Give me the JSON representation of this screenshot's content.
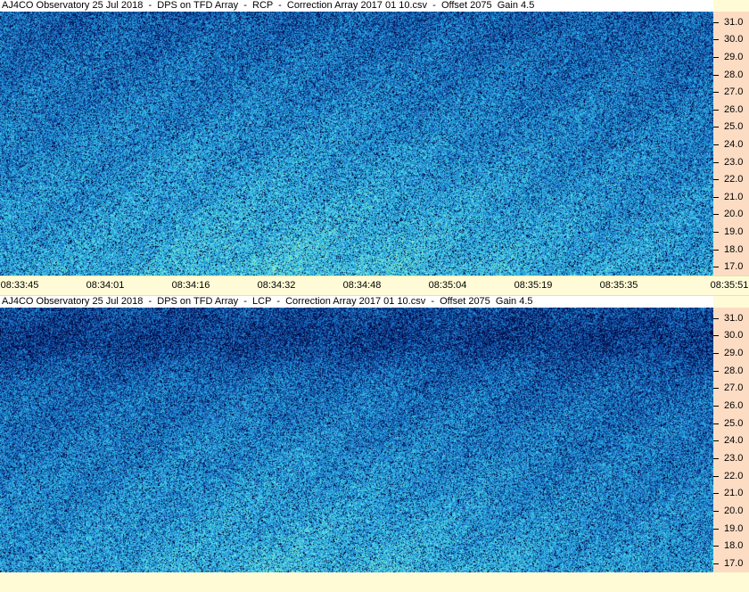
{
  "chart_data": [
    {
      "type": "heatmap",
      "title": "AJ4CO Observatory 25 Jul 2018  -  DPS on TFD Array  -  RCP  -  Correction Array 2017 01 10.csv  -  Offset 2075  Gain 4.5",
      "xlabel": "",
      "ylabel": "",
      "x_ticks": [
        "08:33:45",
        "08:34:01",
        "08:34:16",
        "08:34:32",
        "08:34:48",
        "08:35:04",
        "08:35:19",
        "08:35:35",
        "08:35:51"
      ],
      "y_ticks": [
        "31.0",
        "30.0",
        "29.0",
        "28.0",
        "27.0",
        "26.0",
        "25.0",
        "24.0",
        "23.0",
        "22.0",
        "21.0",
        "20.0",
        "19.0",
        "18.0",
        "17.0"
      ],
      "ylim": [
        16.5,
        31.6
      ],
      "colormap": [
        "#000033",
        "#0a2e7a",
        "#1a6fc9",
        "#2aaee0",
        "#5fe6e6",
        "#c8f59a"
      ],
      "description_values": {
        "intensity_trend": "higher at lower frequencies (17-22) and mid-time, lower near 28-31"
      }
    },
    {
      "type": "heatmap",
      "title": "AJ4CO Observatory 25 Jul 2018  -  DPS on TFD Array  -  LCP  -  Correction Array 2017 01 10.csv  -  Offset 2075  Gain 4.5",
      "xlabel": "",
      "ylabel": "",
      "x_ticks": [],
      "y_ticks": [
        "31.0",
        "30.0",
        "29.0",
        "28.0",
        "27.0",
        "26.0",
        "25.0",
        "24.0",
        "23.0",
        "22.0",
        "21.0",
        "20.0",
        "19.0",
        "18.0",
        "17.0"
      ],
      "ylim": [
        16.5,
        31.6
      ],
      "colormap": [
        "#000033",
        "#0a2e7a",
        "#1a6fc9",
        "#2aaee0",
        "#5fe6e6",
        "#c8f59a"
      ],
      "description_values": {
        "intensity_trend": "darker band near 29-31, brighter near 17-21"
      }
    }
  ]
}
